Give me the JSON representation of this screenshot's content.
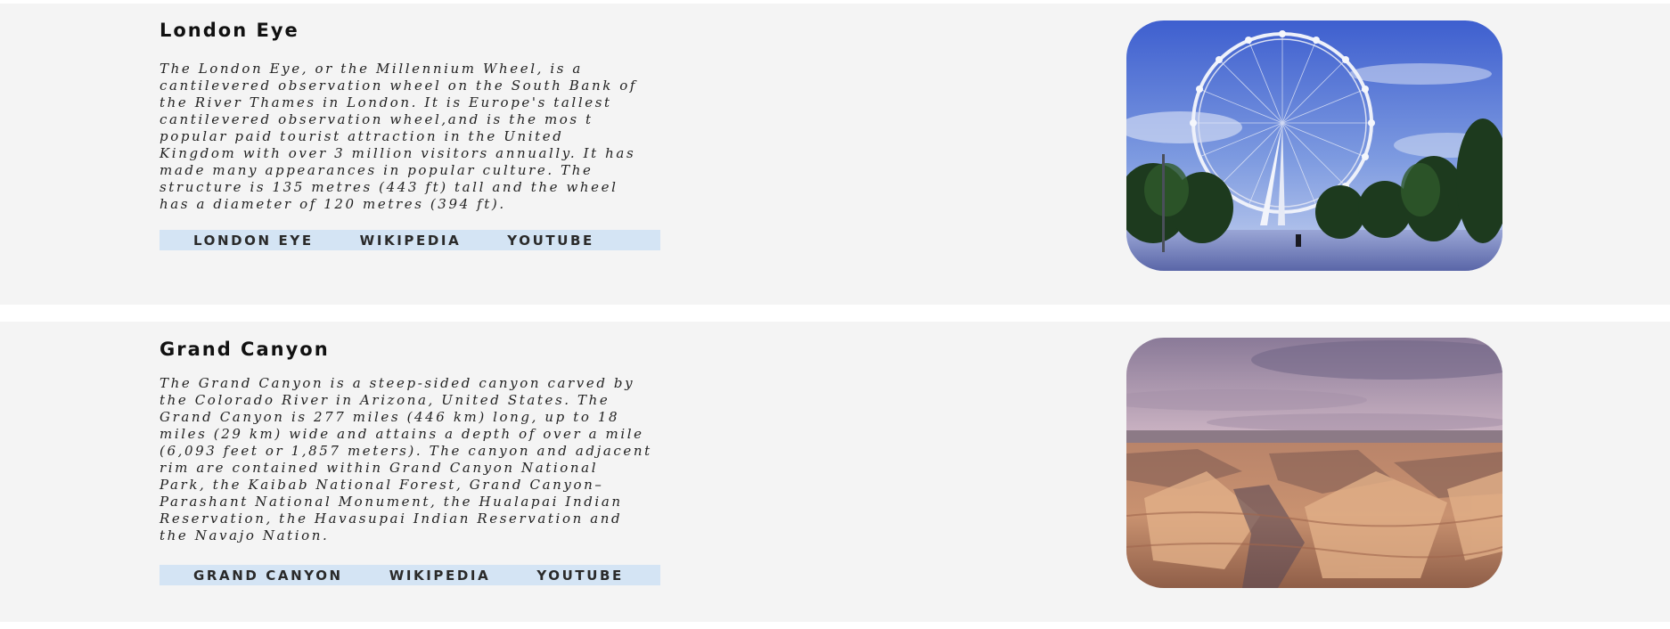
{
  "attractions": [
    {
      "title": "London Eye",
      "description": "The London Eye, or the Millennium Wheel, is a\ncantilevered observation wheel on the South Bank of\nthe River Thames in London. It is Europe's tallest\ncantilevered observation wheel,and is the mos t\npopular paid tourist attraction in the United\nKingdom with over 3 million visitors annually. It has\nmade many appearances in popular culture. The\nstructure is 135 metres (443 ft) tall and the wheel\nhas a diameter of 120 metres (394 ft).",
      "links": [
        "LONDON EYE",
        "WIKIPEDIA",
        "YOUTUBE"
      ],
      "image_subject": "london-eye-photo"
    },
    {
      "title": "Grand Canyon",
      "description": "The Grand Canyon is a steep-sided canyon carved by\nthe Colorado River in Arizona, United States. The\nGrand Canyon is 277 miles (446 km) long, up to 18\nmiles (29 km) wide and attains a depth of over a mile\n(6,093 feet or 1,857 meters). The canyon and adjacent\nrim are contained within Grand Canyon National\nPark, the Kaibab National Forest, Grand Canyon–\nParashant National Monument, the Hualapai Indian\nReservation, the Havasupai Indian Reservation and\nthe Navajo Nation.",
      "links": [
        "GRAND CANYON",
        "WIKIPEDIA",
        "YOUTUBE"
      ],
      "image_subject": "grand-canyon-photo"
    }
  ],
  "colors": {
    "card_background": "#f4f4f4",
    "link_bar": "#d4e4f4",
    "title_text": "#111111"
  }
}
